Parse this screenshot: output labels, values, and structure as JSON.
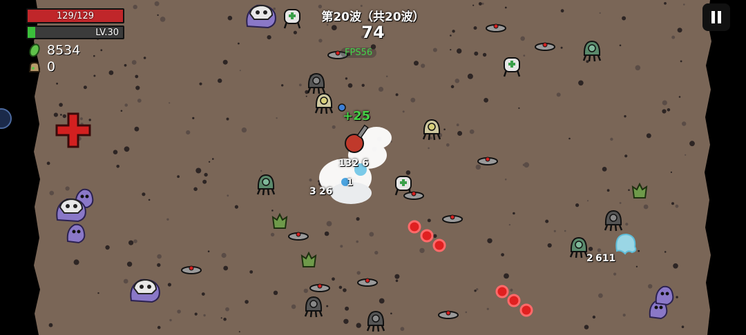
{
  "hud": {
    "hp_text": "129/129",
    "hp_fraction": 1.0,
    "level_text": "LV.30",
    "xp_fraction": 0.08,
    "materials": "8534",
    "bag_count": "0",
    "wave_text": "第20波（共20波）",
    "timer": "74",
    "fps": "FPS56"
  },
  "colors": {
    "hp": "#c0262a",
    "xp": "#3bbf3b",
    "ground": "#7a6657",
    "border": "#0a0a0a"
  },
  "icons": {
    "materials": "green-material-icon",
    "bag": "bag-icon",
    "pause": "pause-icon"
  },
  "floating_texts": [
    {
      "text": "+25",
      "color": "#45d045"
    },
    {
      "text": "132",
      "color": "#ffffff"
    },
    {
      "text": "6",
      "color": "#ffffff"
    },
    {
      "text": "3",
      "color": "#ffffff"
    },
    {
      "text": "26",
      "color": "#ffffff"
    },
    {
      "text": "1",
      "color": "#ffffff"
    },
    {
      "text": "2",
      "color": "#ffffff"
    },
    {
      "text": "611",
      "color": "#ffffff"
    }
  ]
}
